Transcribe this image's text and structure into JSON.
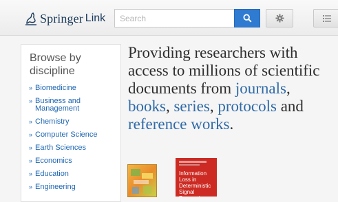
{
  "header": {
    "logo": {
      "word1": "Springer",
      "word2": "Link"
    },
    "search": {
      "placeholder": "Search",
      "value": ""
    },
    "search_button_icon": "search-icon",
    "settings_button_icon": "gear-icon",
    "menu_button_icon": "list-menu-icon"
  },
  "sidebar": {
    "title": "Browse by discipline",
    "items": [
      {
        "label": "Biomedicine"
      },
      {
        "label": "Business and Management"
      },
      {
        "label": "Chemistry"
      },
      {
        "label": "Computer Science"
      },
      {
        "label": "Earth Sciences"
      },
      {
        "label": "Economics"
      },
      {
        "label": "Education"
      },
      {
        "label": "Engineering"
      }
    ],
    "bullet": "»"
  },
  "hero": {
    "intro": "Providing researchers with access to millions of scientific documents from",
    "links": {
      "journals": "journals",
      "books": "books",
      "series": "series",
      "protocols": "protocols",
      "reference_works": "reference works"
    },
    "sep_comma": ",",
    "and": "and",
    "period": "."
  },
  "books": [
    {
      "title": ""
    },
    {
      "title": "Information Loss in Deterministic Signal Processing"
    }
  ],
  "colors": {
    "accent": "#2f7bd1",
    "link": "#1f67b3",
    "hero_link": "#2f6aa8",
    "text": "#2e2e2e",
    "book_red": "#cc2a22"
  }
}
